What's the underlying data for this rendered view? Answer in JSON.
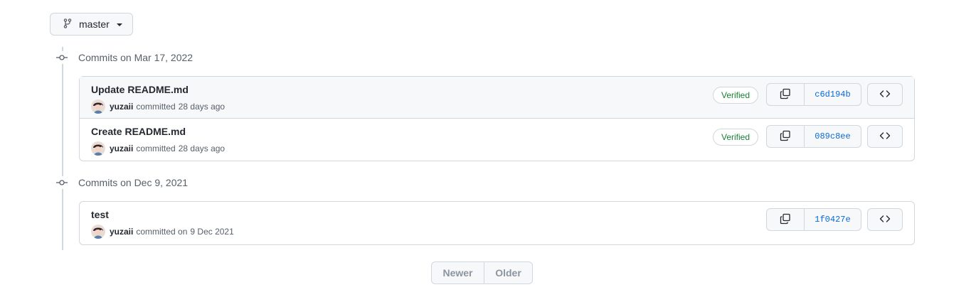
{
  "branch": {
    "name": "master"
  },
  "groups": [
    {
      "date_label": "Commits on Mar 17, 2022",
      "commits": [
        {
          "title": "Update README.md",
          "author": "yuzaii",
          "action": "committed",
          "time": "28 days ago",
          "verified": "Verified",
          "sha": "c6d194b"
        },
        {
          "title": "Create README.md",
          "author": "yuzaii",
          "action": "committed",
          "time": "28 days ago",
          "verified": "Verified",
          "sha": "089c8ee"
        }
      ]
    },
    {
      "date_label": "Commits on Dec 9, 2021",
      "commits": [
        {
          "title": "test",
          "author": "yuzaii",
          "action": "committed on",
          "time": "9 Dec 2021",
          "verified": "",
          "sha": "1f0427e"
        }
      ]
    }
  ],
  "pagination": {
    "newer": "Newer",
    "older": "Older"
  },
  "colors": {
    "verified": "#1a7f37",
    "sha": "#0969da",
    "border": "#d0d7de",
    "muted": "#57606a"
  }
}
